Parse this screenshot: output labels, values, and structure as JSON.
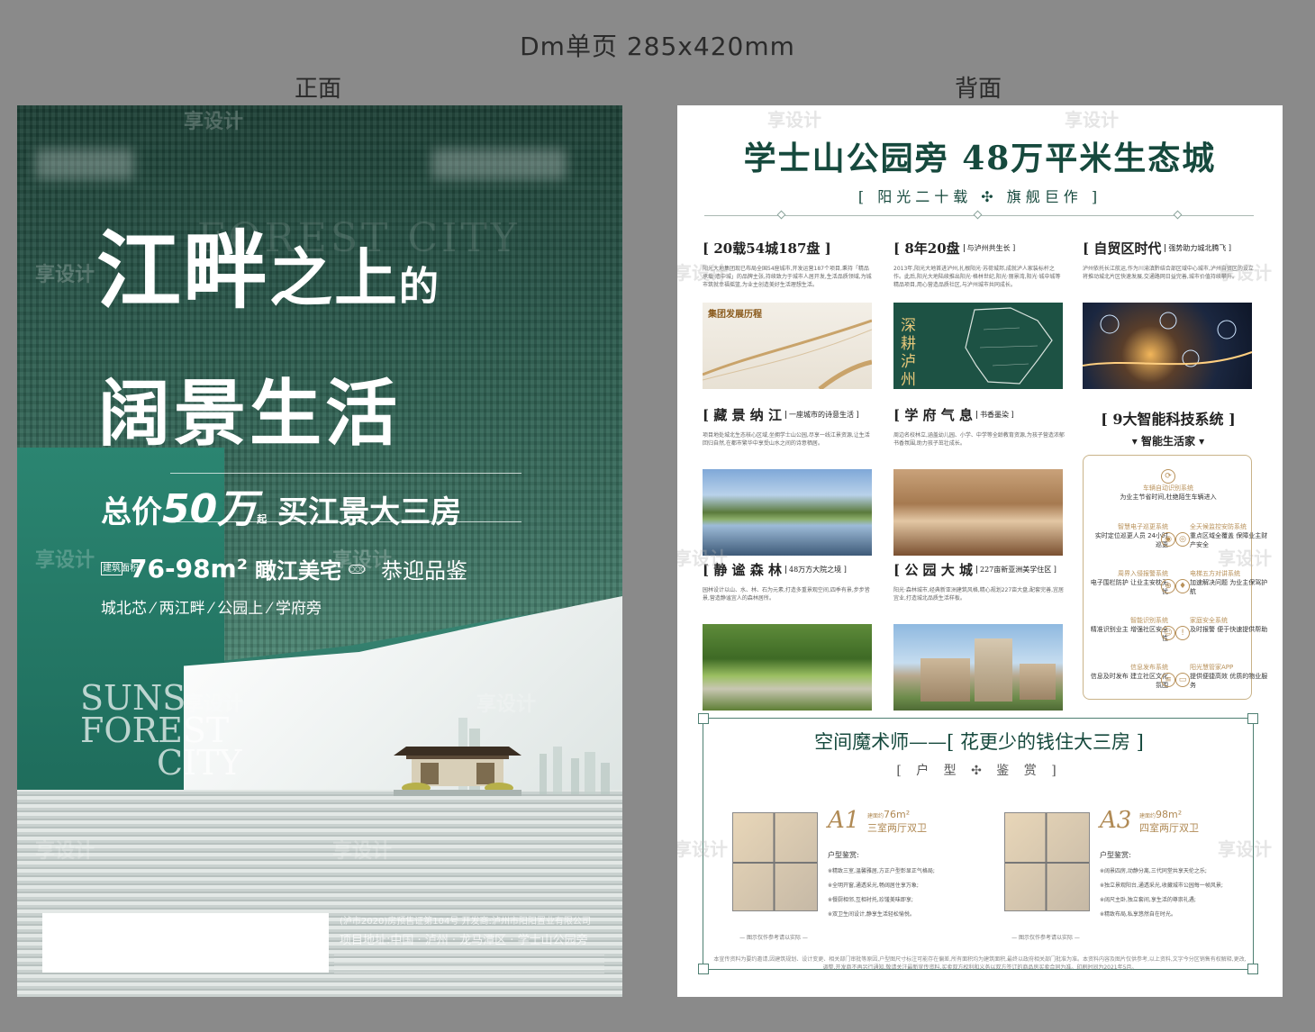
{
  "header": {
    "title": "Dm单页  285x420mm",
    "front_label": "正面",
    "back_label": "背面"
  },
  "colors": {
    "background": "#8a8a8a",
    "brand_green": "#16493d",
    "gold": "#b8915a"
  },
  "front": {
    "headline_1a": "江畔",
    "headline_1b": "之上",
    "headline_1c": "的",
    "headline_2": "阔景生活",
    "price_prefix": "总价",
    "price_value": "50万",
    "price_suffix": "起",
    "price_tail": "买江景大三房",
    "area_badge": "建筑面积",
    "area_value": "76-98m²",
    "area_desc": "瞰江美宅",
    "area_icon_label": "○○○",
    "area_welcome": "恭迎品鉴",
    "tags": "城北芯 ⁄ 两江畔 ⁄ 公园上 ⁄ 学府旁",
    "ghost_top": "FOREST CITY",
    "ghost_low_1": "SUNS",
    "ghost_low_2": "FOREST",
    "ghost_low_3": "CITY",
    "license": "(泸市2020)房预售证第104号  开发商:泸州市阳阳置业有限公司",
    "address": "项目地址:中国 · 泸州 · 龙马潭区 · 学士山公园旁",
    "watermark": "享设计"
  },
  "back": {
    "title": "学士山公园旁  48万平米生态城",
    "subtitle": "[ 阳光二十载 ✣ 旗舰巨作 ]",
    "sections": [
      {
        "title": "[ 20载54城187盘 ]",
        "sub": "",
        "body": "阳光大地集团现已布局全国54座城市,开发运营187个项目,秉持「精品承载·墙中城」的品牌主张,持续致力于城市人居开发,生活品质领域,为城市筑就幸福摇篮,为业主创造美好生活理想生活。",
        "image_caption": "集团发展历程"
      },
      {
        "title": "[ 8年20盘",
        "sub": "与泸州共生长 ]",
        "body": "2013年,阳光大地首进泸州,扎根阳光·苏荷城邦,成就泸人家装标杆之作。此后,阳光大地陆续推出阳光·格林世纪,阳光·丽景湾,阳光·城中城等精品项目,用心营造品质社区,与泸州城市共同成长。",
        "image_caption": "深耕泸州八年"
      },
      {
        "title": "[ 自贸区时代",
        "sub": "强势助力城北腾飞 ]",
        "body": "泸州依托长江航运,作为川渝滇黔结合部区域中心城市,泸州自贸区的设立将推动城北片区快速发展,交通路网日益完善,城市价值持续攀升。",
        "image_caption": ""
      },
      {
        "title": "[ 藏 景 纳 江",
        "sub": "一座城市的诗意生活 ]",
        "body": "项目地处城北生态核心区域,坐拥学士山公园,尽享一线江景资源,让生活回归自然,在都市繁华中享受山水之间的诗意栖居。",
        "image_caption": ""
      },
      {
        "title": "[ 学 府 气 息",
        "sub": "书香墨染 ]",
        "body": "周边名校林立,涵盖幼儿园、小学、中学等全龄教育资源,为孩子营造浓郁书香氛围,助力孩子茁壮成长。",
        "image_caption": ""
      },
      {
        "title": "[ 静 谧 森 林",
        "sub": "48万方大院之境 ]",
        "body": "园林设计以山、水、林、石为元素,打造多重景观空间,四季有景,步步皆景,营造静谧宜人的森林居所。",
        "image_caption": ""
      },
      {
        "title": "[ 公 园 大 城",
        "sub": "227亩新亚洲美学住区 ]",
        "body": "阳光·森林城市,经典新亚洲建筑风格,精心规划227亩大盘,配套完善,宜居宜业,打造城北品质生活样板。",
        "image_caption": ""
      }
    ],
    "smart_title": "[ 9大智能科技系统 ]",
    "smart_sub": "▾ 智能生活家 ▾",
    "smart_center": {
      "title": "车辆自动识别系统",
      "desc": "为业主节省时间,杜绝陌生车辆进入"
    },
    "smart_items": [
      {
        "title": "智慧电子巡更系统",
        "desc": "实时定位巡更人员 24小时巡更"
      },
      {
        "title": "全天候监控安防系统",
        "desc": "重点区域全覆盖 保障业主财产安全"
      },
      {
        "title": "周界入侵报警系统",
        "desc": "电子围栏防护 让业主安枕无忧"
      },
      {
        "title": "电梯五方对讲系统",
        "desc": "加速解决问题 为业主保驾护航"
      },
      {
        "title": "智能识别系统",
        "desc": "精准识别业主 增强社区安全性"
      },
      {
        "title": "家庭安全系统",
        "desc": "及时报警 便于快速提供帮助"
      },
      {
        "title": "信息发布系统",
        "desc": "信息及时发布 建立社区文化氛围"
      },
      {
        "title": "阳光慧管家APP",
        "desc": "提供便捷高效 优质的物业服务"
      }
    ],
    "fp_title": "空间魔术师——[ 花更少的钱住大三房 ]",
    "fp_sub": "[ 户 型 ✣ 鉴 赏 ]",
    "units": [
      {
        "code": "A1",
        "area_label": "建面约",
        "area_value": "76m²",
        "layout": "三室两厅双卫",
        "head": "户型鉴赏:",
        "features": [
          "※精致三室,温馨雅居,方正户型彰显正气格局;",
          "※全明开窗,通透采光,畅阔居住享万象;",
          "※餐厨相邻,互相衬托,珍馐美味即享;",
          "※双卫生间设计,静享生活轻松愉悦。"
        ],
        "caption": "— 图示仅作参考请以实际 —"
      },
      {
        "code": "A3",
        "area_label": "建面约",
        "area_value": "98m²",
        "layout": "四室两厅双卫",
        "head": "户型鉴赏:",
        "features": [
          "※阔景四房,动静分离,三代同堂共享天伦之乐;",
          "※独立景观阳台,通透采光,收藏城市公园每一帧风景;",
          "※阔尺主卧,独立套间,享生活的尊崇礼遇;",
          "※精致布局,私享悠然自在时光。"
        ],
        "caption": "— 图示仅作参考请以实际 —"
      }
    ],
    "disclaimer": "本宣传资料为要约邀请,因建筑规划、设计变更、相关部门审批等原因,户型图尺寸标注可能存在偏差,所有面积均为建筑面积,最终以政府相关部门批准为准。本资料内容及图片仅供参考,以上资料,文字今分区销售有权解释,更改,调整,开发商不再另行通知,敬请关注最新宣传资料,买卖双方权利和义务以双方签订的商品房买卖合同为准。印刷时间为2021年5月。",
    "watermark": "享设计"
  }
}
